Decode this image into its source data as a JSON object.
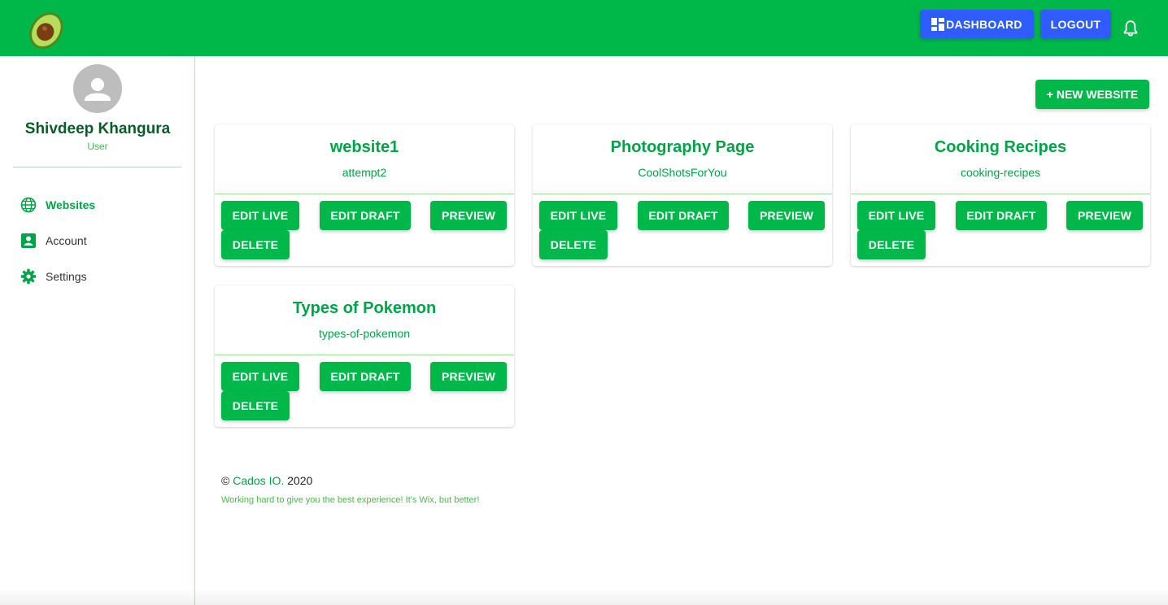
{
  "header": {
    "logo_icon": "avocado-logo",
    "dashboard_label": "DASHBOARD",
    "logout_label": "LOGOUT",
    "notification_icon": "bell-icon",
    "brand_color": "#00b74a",
    "accent_color": "#2f5cff"
  },
  "sidebar": {
    "user": {
      "name": "Shivdeep Khangura",
      "role": "User"
    },
    "items": [
      {
        "label": "Websites",
        "icon": "globe-icon",
        "active": true
      },
      {
        "label": "Account",
        "icon": "account-box-icon",
        "active": false
      },
      {
        "label": "Settings",
        "icon": "gear-icon",
        "active": false
      }
    ]
  },
  "main": {
    "new_website_label": "+ NEW WEBSITE",
    "actions": {
      "edit_live": "EDIT LIVE",
      "edit_draft": "EDIT DRAFT",
      "preview": "PREVIEW",
      "delete": "DELETE"
    },
    "websites": [
      {
        "title": "website1",
        "slug": "attempt2"
      },
      {
        "title": "Photography Page",
        "slug": "CoolShotsForYou"
      },
      {
        "title": "Cooking Recipes",
        "slug": "cooking-recipes"
      },
      {
        "title": "Types of Pokemon",
        "slug": "types-of-pokemon"
      }
    ]
  },
  "footer": {
    "copyright": "©",
    "company": "Cados IO.",
    "year": "2020",
    "tagline": "Working hard to give you the best experience! It's Wix, but better!"
  }
}
